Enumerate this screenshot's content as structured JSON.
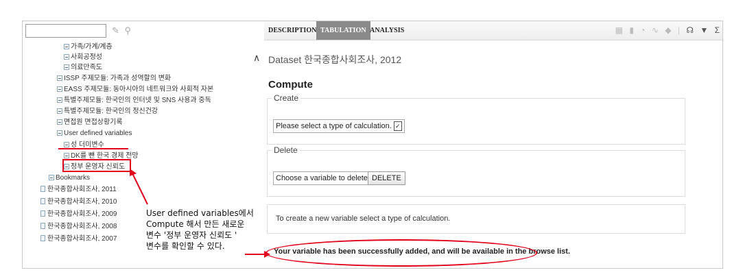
{
  "search": {
    "value": "",
    "icons": [
      "pencil-icon",
      "search-icon"
    ]
  },
  "tree": {
    "items": [
      {
        "label": "가족/가계/계층",
        "kind": "box"
      },
      {
        "label": "사회공정성",
        "kind": "box"
      },
      {
        "label": "의료만족도",
        "kind": "box"
      },
      {
        "label": "ISSP 주제모듈: 가족과 성역할의 변화",
        "kind": "box"
      },
      {
        "label": "EASS 주제모듈: 동아시아의 네트워크와 사회적 자본",
        "kind": "box"
      },
      {
        "label": "특별주제모듈: 한국인의 인터넷 및 SNS 사용과 중독",
        "kind": "box"
      },
      {
        "label": "특별주제모듈: 한국인의 정신건강",
        "kind": "box"
      },
      {
        "label": "면접원 면접상황기록",
        "kind": "box"
      },
      {
        "label": "User defined variables",
        "kind": "box"
      },
      {
        "label": "성 더미변수",
        "kind": "box"
      },
      {
        "label": "DK를 뺀 한국 경제 전망",
        "kind": "box"
      },
      {
        "label": "정부 운영자 신뢰도",
        "kind": "box"
      },
      {
        "label": "Bookmarks",
        "kind": "box"
      },
      {
        "label": "한국종합사회조사, 2011",
        "kind": "doc"
      },
      {
        "label": "한국종합사회조사, 2010",
        "kind": "doc"
      },
      {
        "label": "한국종합사회조사, 2009",
        "kind": "doc"
      },
      {
        "label": "한국종합사회조사, 2008",
        "kind": "doc"
      },
      {
        "label": "한국종합사회조사, 2007",
        "kind": "doc"
      }
    ]
  },
  "callout": {
    "lines": [
      "User defined variables에서",
      "Compute 해서 만든 새로운",
      "변수 '정부 운영자 신뢰도 '",
      "변수를 확인할 수 있다."
    ]
  },
  "tabs": {
    "description": "DESCRIPTION",
    "tabulation": "TABULATION",
    "analysis": "ANALYSIS",
    "active": "TABULATION"
  },
  "toolbar": {
    "icons": [
      "table-icon",
      "bar-chart-icon",
      "pie-chart-icon",
      "line-chart-icon",
      "map-icon",
      "headphones-icon",
      "filter-icon",
      "sigma-icon"
    ],
    "sigma": "Σ"
  },
  "main": {
    "dataset_prefix": "Dataset",
    "dataset_name": "한국종합사회조사, 2012",
    "compute_title": "Compute",
    "create_legend": "Create",
    "create_select": "Please select a type of calculation.",
    "delete_legend": "Delete",
    "delete_select": "Choose a variable to delete",
    "delete_button": "DELETE",
    "info_text": "To create a new variable select a type of calculation.",
    "success_text": "Your variable has been successfully added, and will be available in the browse list."
  },
  "colors": {
    "annotation": "#e2001a",
    "active_tab": "#8a8a8a"
  }
}
